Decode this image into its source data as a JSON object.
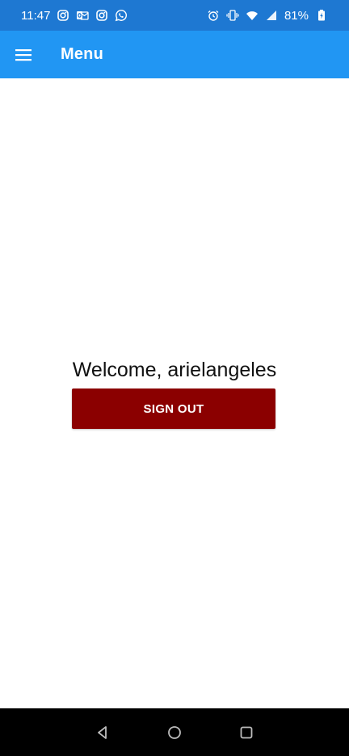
{
  "status": {
    "time": "11:47",
    "battery": "81%",
    "left_icons": [
      "instagram-icon",
      "outlook-icon",
      "instagram-icon",
      "whatsapp-icon"
    ],
    "right_icons": [
      "alarm-icon",
      "vibrate-icon",
      "wifi-icon",
      "signal-icon",
      "battery-charging-icon"
    ]
  },
  "appbar": {
    "title": "Menu",
    "menu_icon": "hamburger-menu-icon"
  },
  "main": {
    "welcome": "Welcome, arielangeles",
    "signout_label": "SIGN OUT"
  },
  "navbar": {
    "icons": [
      "back-icon",
      "home-icon",
      "recents-icon"
    ]
  },
  "colors": {
    "status_bar": "#1e78d2",
    "app_bar": "#2196f3",
    "signout_button": "#8b0000",
    "nav_bar": "#000000"
  }
}
